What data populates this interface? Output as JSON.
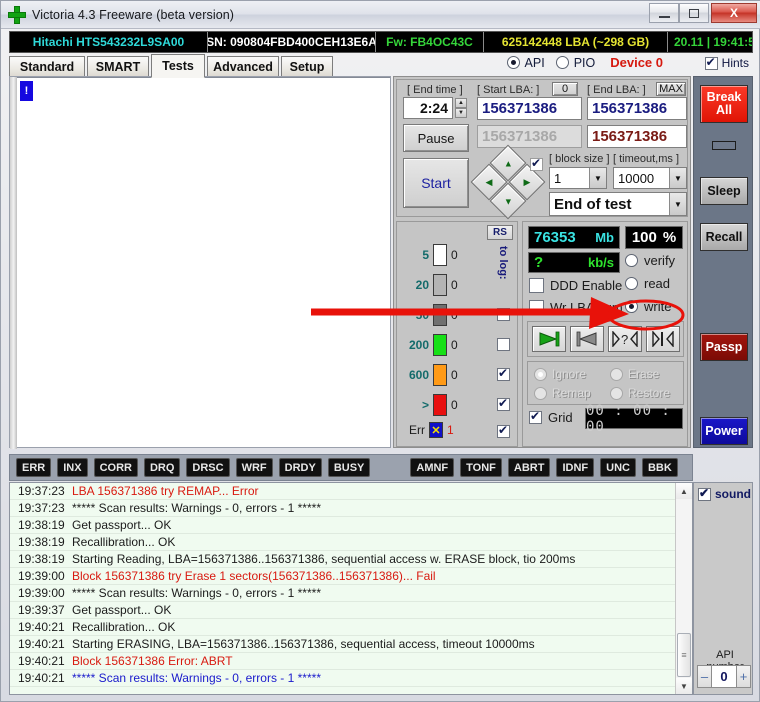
{
  "window": {
    "title": "Victoria 4.3 Freeware (beta version)",
    "icon": "green-cross-icon",
    "buttons": {
      "minimize": "–",
      "maximize": "❐",
      "close": "X"
    }
  },
  "infobar": {
    "model": "Hitachi HTS543232L9SA00",
    "serial": "SN: 090804FBD400CEH13E6A",
    "firmware": "Fw: FB4OC43C",
    "capacity": "625142448 LBA (~298 GB)",
    "clock": "20.11 | 19:41:5"
  },
  "tabs": [
    {
      "label": "Standard",
      "active": false
    },
    {
      "label": "SMART",
      "active": false
    },
    {
      "label": "Tests",
      "active": true
    },
    {
      "label": "Advanced",
      "active": false
    },
    {
      "label": "Setup",
      "active": false
    }
  ],
  "topbar": {
    "api_label": "API",
    "pio_label": "PIO",
    "api_selected": true,
    "device_label": "Device 0",
    "hints_label": "Hints",
    "hints_checked": true
  },
  "canvas": {
    "marker": "!"
  },
  "controls": {
    "end_time_label": "[ End time ]",
    "end_time_value": "2:24",
    "pause_label": "Pause",
    "start_label": "Start",
    "start_lba_label": "[ Start LBA: ]",
    "start_lba_zero_button": "0",
    "start_lba_value": "156371386",
    "start_lba_current": "156371386",
    "end_lba_label": "[ End LBA: ]",
    "end_lba_max_button": "MAX",
    "end_lba_value": "156371386",
    "end_lba_current": "156371386",
    "block_size_label": "[ block size ]",
    "block_size_value": "1",
    "timeout_label": "[ timeout,ms ]",
    "timeout_value": "10000",
    "end_of_test_value": "End of test",
    "dpad_checkbox_checked": true
  },
  "scale": {
    "rs_button": "RS",
    "to_log_label": "to log:",
    "rows": [
      {
        "threshold": "5",
        "color": "#ffffff",
        "count": "0",
        "to_log": null
      },
      {
        "threshold": "20",
        "color": "#b4b4b4",
        "count": "0",
        "to_log": null
      },
      {
        "threshold": "50",
        "color": "#707070",
        "count": "0",
        "to_log": false
      },
      {
        "threshold": "200",
        "color": "#16e016",
        "count": "0",
        "to_log": false
      },
      {
        "threshold": "600",
        "color": "#ff9a16",
        "count": "0",
        "to_log": true
      },
      {
        "threshold": ">",
        "color": "#e81010",
        "count": "0",
        "to_log": true
      },
      {
        "threshold": "Err",
        "color": "#1010c8",
        "count": "1",
        "to_log": true
      }
    ]
  },
  "readout": {
    "size_value": "76353",
    "size_unit": "Mb",
    "percent_value": "100",
    "percent_unit": "%",
    "speed_value": "?",
    "speed_unit": "kb/s",
    "ddd_enable_label": "DDD Enable",
    "ddd_enable_checked": false,
    "wr_lba_label": "Wr LBA num",
    "wr_lba_checked": false
  },
  "modes": {
    "options": [
      "verify",
      "read",
      "write"
    ],
    "selected": "write"
  },
  "transport": {
    "buttons": [
      "play-forward",
      "play-backward",
      "random-seek",
      "butterfly-seek"
    ]
  },
  "actions": {
    "options": [
      "Ignore",
      "Erase",
      "Remap",
      "Restore"
    ],
    "selected": "Ignore",
    "disabled": true
  },
  "grid": {
    "label": "Grid",
    "checked": true,
    "timer": "00 : 00 : 00"
  },
  "sidebar": {
    "buttons": [
      {
        "label": "Break All",
        "style": "red"
      },
      {
        "label": "Sleep",
        "style": "grey"
      },
      {
        "label": "Recall",
        "style": "grey"
      },
      {
        "label": "Passp",
        "style": "dkred"
      },
      {
        "label": "Power",
        "style": "blue"
      }
    ]
  },
  "flags": {
    "left": [
      "ERR",
      "INX",
      "CORR",
      "DRQ",
      "DRSC",
      "WRF",
      "DRDY",
      "BUSY"
    ],
    "right": [
      "AMNF",
      "TONF",
      "ABRT",
      "IDNF",
      "UNC",
      "BBK"
    ]
  },
  "log": {
    "rows": [
      {
        "time": "19:37:23",
        "msg": "LBA 156371386 try REMAP... Error",
        "color": "m-red"
      },
      {
        "time": "19:37:23",
        "msg": "***** Scan results: Warnings - 0, errors - 1 *****",
        "color": "m-black"
      },
      {
        "time": "19:38:19",
        "msg": "Get passport... OK",
        "color": "m-black"
      },
      {
        "time": "19:38:19",
        "msg": "Recallibration... OK",
        "color": "m-black"
      },
      {
        "time": "19:38:19",
        "msg": "Starting Reading, LBA=156371386..156371386, sequential access w. ERASE block, tio 200ms",
        "color": "m-black"
      },
      {
        "time": "19:39:00",
        "msg": "Block 156371386 try Erase 1 sectors(156371386..156371386)... Fail",
        "color": "m-red"
      },
      {
        "time": "19:39:00",
        "msg": "***** Scan results: Warnings - 0, errors - 1 *****",
        "color": "m-black"
      },
      {
        "time": "19:39:37",
        "msg": "Get passport... OK",
        "color": "m-black"
      },
      {
        "time": "19:40:21",
        "msg": "Recallibration... OK",
        "color": "m-black"
      },
      {
        "time": "19:40:21",
        "msg": "Starting ERASING, LBA=156371386..156371386, sequential access, timeout 10000ms",
        "color": "m-black"
      },
      {
        "time": "19:40:21",
        "msg": "Block 156371386 Error: ABRT",
        "color": "m-red"
      },
      {
        "time": "19:40:21",
        "msg": "***** Scan results: Warnings - 0, errors - 1 *****",
        "color": "m-blue"
      }
    ]
  },
  "bottomright": {
    "sound_label": "sound",
    "sound_checked": true,
    "api_number_label": "API number",
    "api_number_value": "0",
    "minus": "–",
    "plus": "+"
  },
  "colors": {
    "accent_red": "#e01405",
    "annotation_red": "#e8120a",
    "panel_bg": "#c5c5c5",
    "sidebar_bg": "#6b7687"
  }
}
